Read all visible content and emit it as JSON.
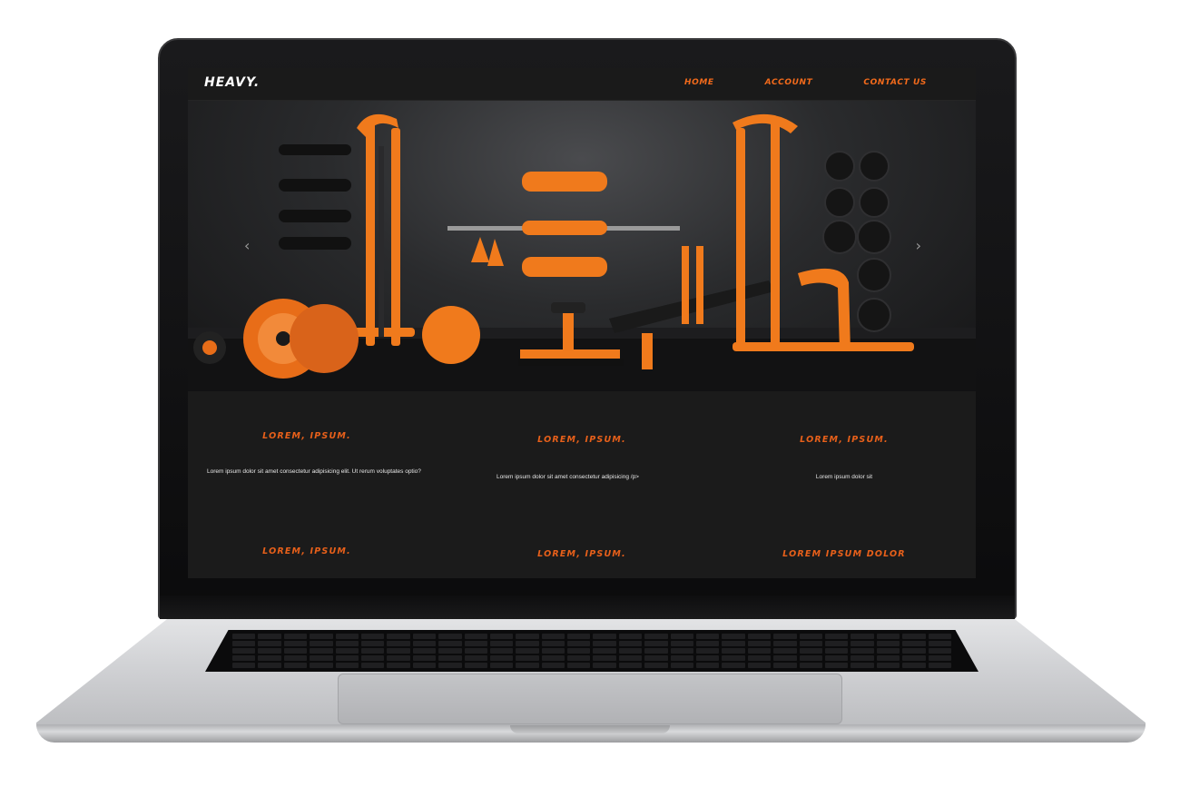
{
  "site": {
    "logo": "HEAVY.",
    "nav": [
      "HOME",
      "ACCOUNT",
      "CONTACT US"
    ]
  },
  "hero": {
    "prev_arrow": "‹",
    "next_arrow": "›"
  },
  "sections": [
    {
      "title": "LOREM, IPSUM.",
      "text": "Lorem ipsum dolor sit amet consectetur adipisicing elit. Ut rerum voluptates optio?"
    },
    {
      "title": "LOREM, IPSUM.",
      "text": "Lorem ipsum dolor sit amet consectetur adipisicing /p>"
    },
    {
      "title": "LOREM, IPSUM.",
      "text": "Lorem ipsum dolor sit"
    },
    {
      "title": "LOREM, IPSUM."
    },
    {
      "title": "LOREM, IPSUM."
    },
    {
      "title": "LOREM IPSUM DOLOR"
    }
  ],
  "colors": {
    "accent": "#f26a1b",
    "background": "#1b1b1b"
  }
}
